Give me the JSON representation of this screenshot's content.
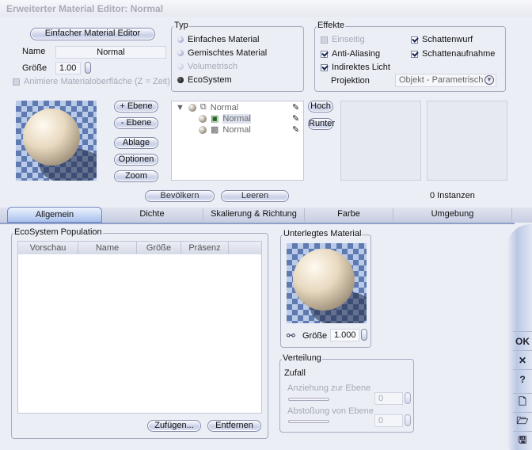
{
  "title": "Erweiterter Material Editor: Normal",
  "top": {
    "simple_editor": "Einfacher Material Editor",
    "name_label": "Name",
    "name_value": "Normal",
    "size_label": "Größe",
    "size_value": "1.00",
    "animate_label": "Animiere Materialoberfläche (Z = Zeit)"
  },
  "typ": {
    "legend": "Typ",
    "options": [
      "Einfaches Material",
      "Gemischtes Material",
      "Volumetrisch",
      "EcoSystem"
    ],
    "selected": "EcoSystem"
  },
  "effekte": {
    "legend": "Effekte",
    "einseitig": "Einseitig",
    "anti_aliasing": "Anti-Aliasing",
    "indirekt": "Indirektes Licht",
    "schattenwurf": "Schattenwurf",
    "schattenaufnahme": "Schattenaufnahme",
    "projektion_label": "Projektion",
    "projektion_value": "Objekt - Parametrisch"
  },
  "layer_buttons": {
    "add": "+ Ebene",
    "remove": "- Ebene",
    "ablage": "Ablage",
    "optionen": "Optionen",
    "zoom": "Zoom",
    "up": "Hoch",
    "down": "Runter"
  },
  "tree": [
    "Normal",
    "Normal",
    "Normal"
  ],
  "populate": {
    "bevoelkern": "Bevölkern",
    "leeren": "Leeren",
    "instances": "0 Instanzen"
  },
  "tabs": [
    "Allgemein",
    "Dichte",
    "Skalierung & Richtung",
    "Farbe",
    "Umgebung"
  ],
  "population": {
    "legend": "EcoSystem Population",
    "columns": [
      "Vorschau",
      "Name",
      "Größe",
      "Präsenz"
    ],
    "add": "Zufügen...",
    "remove": "Entfernen"
  },
  "underlying": {
    "legend": "Unterlegtes Material",
    "size_label": "Größe",
    "size_value": "1.000"
  },
  "verteilung": {
    "legend": "Verteilung",
    "mode": "Zufall",
    "attraction_label": "Anziehung zur Ebene",
    "attraction_value": "0",
    "repulsion_label": "Abstoßung von Ebene",
    "repulsion_value": "0"
  },
  "side": {
    "ok": "OK",
    "cancel": "✕",
    "help": "?"
  }
}
